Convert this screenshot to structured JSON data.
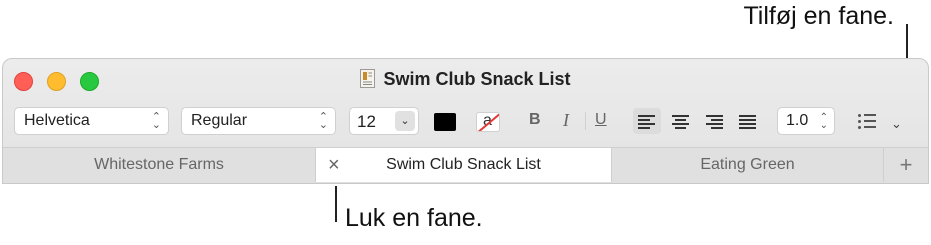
{
  "callouts": {
    "new_tab": "Tilføj en fane.",
    "close_tab": "Luk en fane."
  },
  "window": {
    "title": "Swim Club Snack List"
  },
  "toolbar": {
    "font_family": "Helvetica",
    "font_style": "Regular",
    "font_size": "12",
    "text_color": "#000000",
    "bold_label": "B",
    "italic_label": "I",
    "underline_label": "U",
    "line_spacing": "1.0",
    "active_alignment": "left"
  },
  "tabs": [
    {
      "label": "Whitestone Farms",
      "active": false
    },
    {
      "label": "Swim Club Snack List",
      "active": true
    },
    {
      "label": "Eating Green",
      "active": false
    }
  ],
  "icons": {
    "close_tab": "×",
    "new_tab": "+"
  }
}
